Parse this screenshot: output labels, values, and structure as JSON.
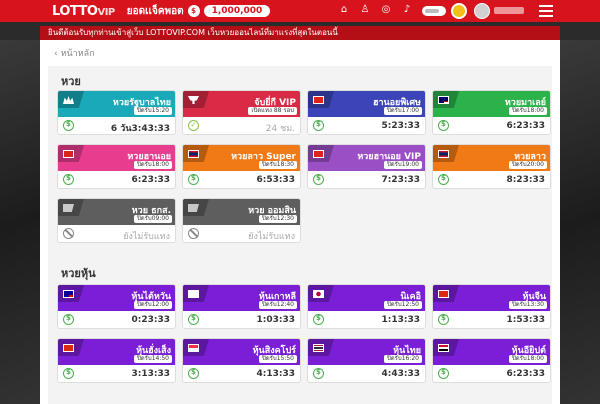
{
  "header": {
    "logo_main": "LOTTO",
    "logo_vip": "VIP",
    "balance_label": "ยอดเเจ็คพอต",
    "coin_label": "$",
    "balance_value": "1,000,000"
  },
  "marquee": "ยินดีต้อนรับทุกท่านเข้าสู่เว็บ LOTTOVIP.COM เว็บหวยออนไลน์ที่มาแรงที่สุดในตอนนี้",
  "back_label": "หน้าหลัก",
  "sections": {
    "lotto": "หวย",
    "stocks": "หวยหุ้น"
  },
  "cards": [
    {
      "name": "หวยรัฐบาลไทย",
      "close": "ปิดรับ15:20",
      "time": "6 วัน3:43:33",
      "color": "#19a9b8",
      "status": "clock"
    },
    {
      "name": "จับยี่กี VIP",
      "close": "เปิดแทง 88 รอบ",
      "time": "24 ชม.",
      "color": "#d92b45",
      "status": "check"
    },
    {
      "name": "ฮานอยพิเศษ",
      "close": "ปิดรับ17:00",
      "time": "5:23:33",
      "color": "#3b45b8",
      "status": "clock"
    },
    {
      "name": "หวยมาเลย์",
      "close": "ปิดรับ18:00",
      "time": "6:23:33",
      "color": "#2bb24b",
      "status": "clock"
    },
    {
      "name": "หวยฮานอย",
      "close": "ปิดรับ18:00",
      "time": "6:23:33",
      "color": "#e83c8f",
      "status": "clock"
    },
    {
      "name": "หวยลาว Super",
      "close": "ปิดรับ18:30",
      "time": "6:53:33",
      "color": "#f07a15",
      "status": "clock"
    },
    {
      "name": "หวยฮานอย VIP",
      "close": "ปิดรับ19:00",
      "time": "7:23:33",
      "color": "#9b4fc4",
      "status": "clock"
    },
    {
      "name": "หวยลาว",
      "close": "ปิดรับ20:00",
      "time": "8:23:33",
      "color": "#f07a15",
      "status": "clock"
    },
    {
      "name": "หวย ธกส.",
      "close": "ปิดรับ09:00",
      "time": "ยังไม่รับแทง",
      "color": "#5e5e5e",
      "status": "ban"
    },
    {
      "name": "หวย ออมสิน",
      "close": "ปิดรับ12:30",
      "time": "ยังไม่รับแทง",
      "color": "#5e5e5e",
      "status": "ban"
    },
    {
      "name": "หุ้นไต้หวัน",
      "close": "ปิดรับ12:00",
      "time": "0:23:33",
      "color": "#7b1fd6",
      "status": "clock"
    },
    {
      "name": "หุ้นเกาหลี",
      "close": "ปิดรับ12:40",
      "time": "1:03:33",
      "color": "#7b1fd6",
      "status": "clock"
    },
    {
      "name": "นิเคอิ",
      "close": "ปิดรับ12:50",
      "time": "1:13:33",
      "color": "#7b1fd6",
      "status": "clock"
    },
    {
      "name": "หุ้นจีน",
      "close": "ปิดรับ13:30",
      "time": "1:53:33",
      "color": "#7b1fd6",
      "status": "clock"
    },
    {
      "name": "หุ้นฮั่งเส็ง",
      "close": "ปิดรับ14:50",
      "time": "3:13:33",
      "color": "#7b1fd6",
      "status": "clock"
    },
    {
      "name": "หุ้นสิงคโปร์",
      "close": "ปิดรับ15:50",
      "time": "4:13:33",
      "color": "#7b1fd6",
      "status": "clock"
    },
    {
      "name": "หุ้นไทย",
      "close": "ปิดรับ16:20",
      "time": "4:43:33",
      "color": "#7b1fd6",
      "status": "clock"
    },
    {
      "name": "หุ้นอียิปต์",
      "close": "ปิดรับ18:00",
      "time": "6:23:33",
      "color": "#7b1fd6",
      "status": "clock"
    }
  ],
  "flags": [
    "thai-crown",
    "trophy",
    "vietnam",
    "malaysia",
    "vietnam",
    "laos",
    "vietnam",
    "laos",
    "grey",
    "grey",
    "taiwan",
    "korea",
    "japan",
    "china",
    "hongkong",
    "singapore",
    "thailand",
    "egypt"
  ]
}
